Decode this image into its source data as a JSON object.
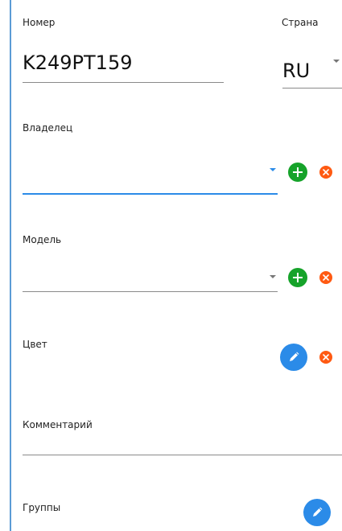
{
  "fields": {
    "number": {
      "label": "Номер",
      "value": "K249PT159"
    },
    "country": {
      "label": "Страна",
      "value": "RU"
    },
    "owner": {
      "label": "Владелец",
      "value": ""
    },
    "model": {
      "label": "Модель",
      "value": ""
    },
    "color": {
      "label": "Цвет"
    },
    "comment": {
      "label": "Комментарий",
      "value": ""
    },
    "groups": {
      "label": "Группы"
    }
  },
  "icons": {
    "add": "plus-icon",
    "clear": "close-icon",
    "edit": "pencil-icon",
    "dropdown": "chevron-down-icon"
  },
  "colors": {
    "accent": "#2b8be8",
    "add": "#16a32a",
    "clear": "#ff5a12",
    "edge": "#5b9bd5"
  }
}
